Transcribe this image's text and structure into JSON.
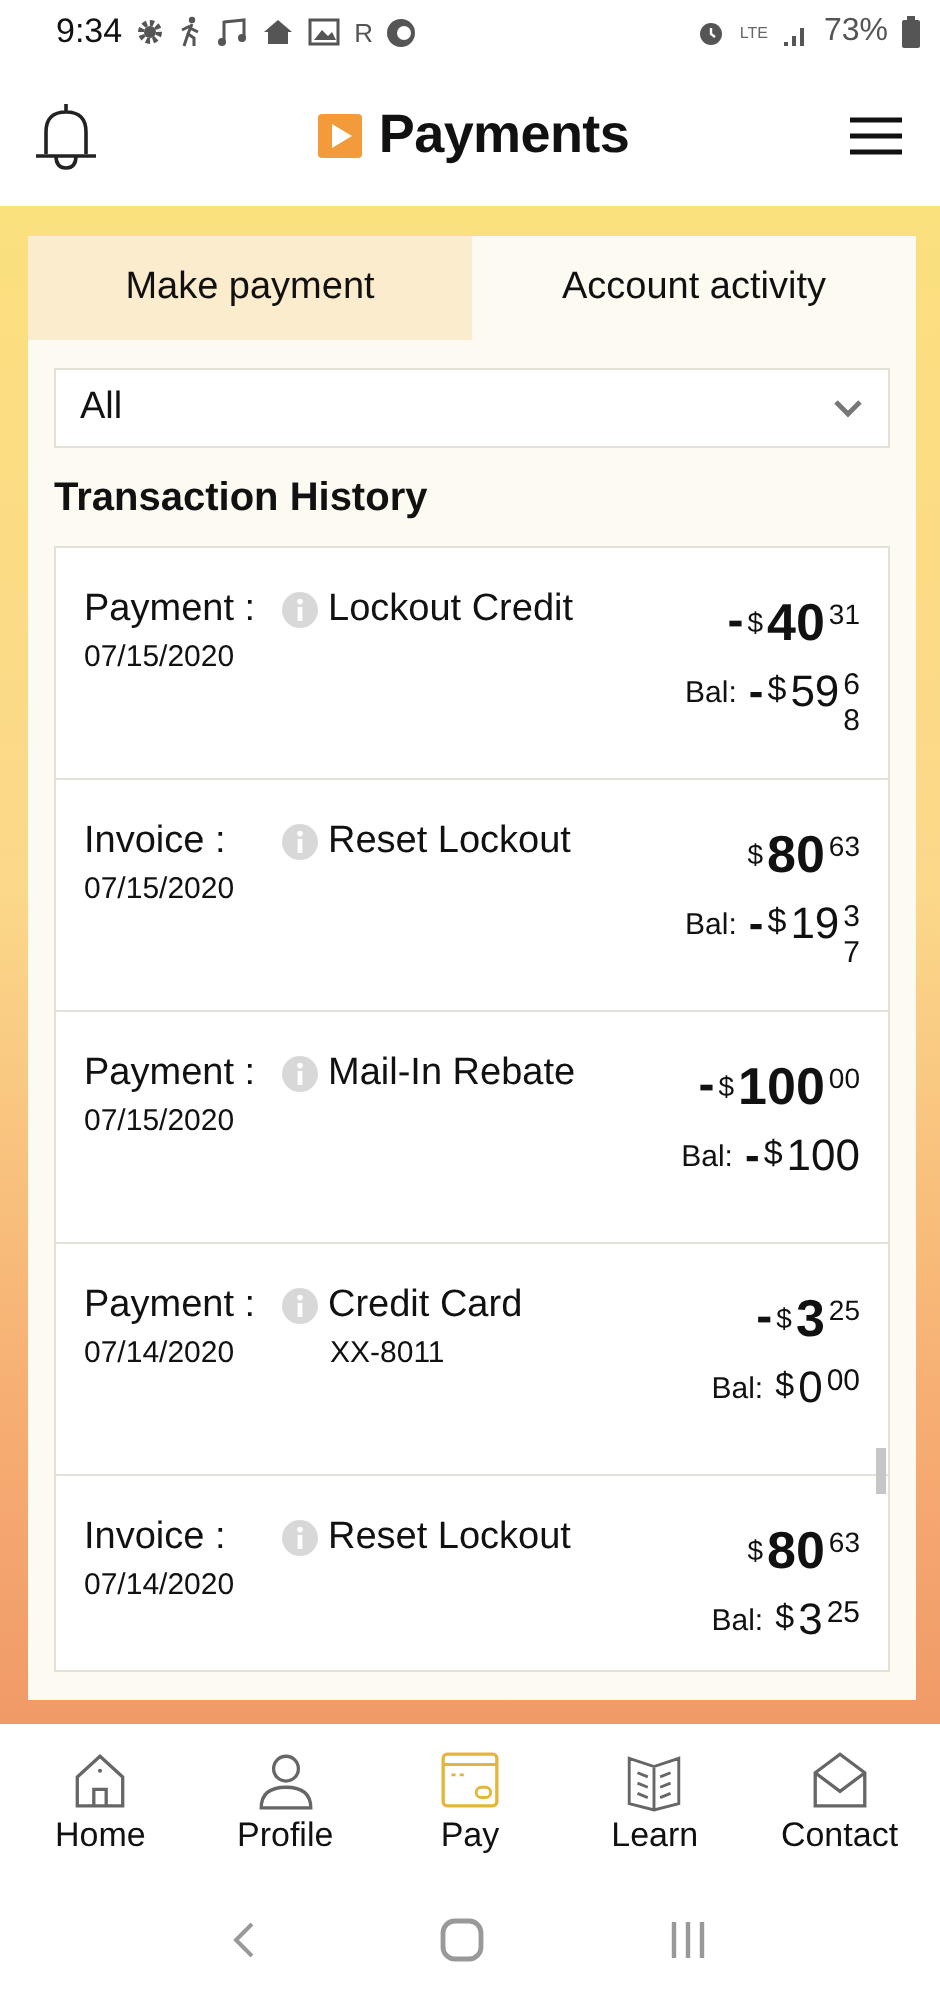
{
  "status_bar": {
    "time": "9:34",
    "roaming": "R",
    "network": "LTE",
    "battery": "73%"
  },
  "header": {
    "title": "Payments"
  },
  "tabs": [
    {
      "label": "Make payment",
      "selected": false
    },
    {
      "label": "Account activity",
      "selected": true
    }
  ],
  "filter": {
    "value": "All"
  },
  "section_title": "Transaction History",
  "transactions": [
    {
      "type": "Payment :",
      "description": "Lockout Credit",
      "date": "07/15/2020",
      "amount": {
        "sign": "-",
        "currency": "$",
        "whole": "40",
        "cents": "31"
      },
      "balance_label": "Bal:",
      "balance": {
        "sign": "-",
        "currency": "$",
        "whole": "59",
        "cents": "68"
      }
    },
    {
      "type": "Invoice :",
      "description": "Reset Lockout",
      "date": "07/15/2020",
      "amount": {
        "currency": "$",
        "whole": "80",
        "cents": "63"
      },
      "balance_label": "Bal:",
      "balance": {
        "sign": "-",
        "currency": "$",
        "whole": "19",
        "cents": "37"
      }
    },
    {
      "type": "Payment :",
      "description": "Mail-In Rebate",
      "date": "07/15/2020",
      "amount": {
        "sign": "-",
        "currency": "$",
        "whole": "100",
        "cents": "00"
      },
      "balance_label": "Bal:",
      "balance": {
        "sign": "-",
        "currency": "$",
        "whole": "100"
      }
    },
    {
      "type": "Payment :",
      "description": "Credit Card",
      "detail": "XX-8011",
      "date": "07/14/2020",
      "amount": {
        "sign": "-",
        "currency": "$",
        "whole": "3",
        "cents": "25"
      },
      "balance_label": "Bal:",
      "balance": {
        "currency": "$",
        "whole": "0",
        "cents": "00"
      }
    },
    {
      "type": "Invoice :",
      "description": "Reset Lockout",
      "date": "07/14/2020",
      "amount": {
        "currency": "$",
        "whole": "80",
        "cents": "63"
      },
      "balance_label": "Bal:",
      "balance": {
        "currency": "$",
        "whole": "3",
        "cents": "25"
      }
    }
  ],
  "nav": [
    {
      "label": "Home",
      "selected": false
    },
    {
      "label": "Profile",
      "selected": false
    },
    {
      "label": "Pay",
      "selected": true
    },
    {
      "label": "Learn",
      "selected": false
    },
    {
      "label": "Contact",
      "selected": false
    }
  ]
}
